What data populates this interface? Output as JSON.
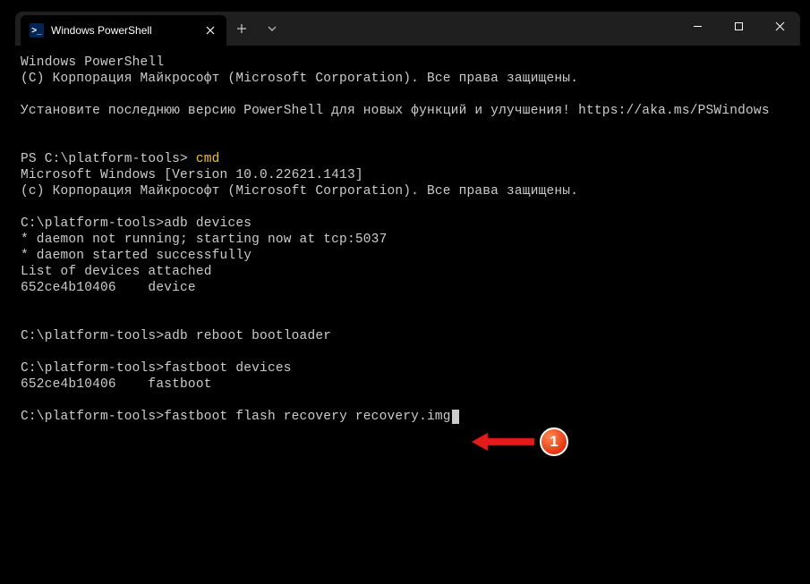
{
  "tab": {
    "title": "Windows PowerShell",
    "icon_text": ">_"
  },
  "terminal": {
    "lines": [
      {
        "t": "Windows PowerShell"
      },
      {
        "t": "(C) Корпорация Майкрософт (Microsoft Corporation). Все права защищены."
      },
      {
        "t": ""
      },
      {
        "t": "Установите последнюю версию PowerShell для новых функций и улучшения! https://aka.ms/PSWindows"
      },
      {
        "t": ""
      },
      {
        "t": ""
      },
      {
        "prompt": "PS C:\\platform-tools> ",
        "cmd": "cmd",
        "cmd_style": "yellow"
      },
      {
        "t": "Microsoft Windows [Version 10.0.22621.1413]"
      },
      {
        "t": "(c) Корпорация Майкрософт (Microsoft Corporation). Все права защищены."
      },
      {
        "t": ""
      },
      {
        "prompt": "C:\\platform-tools>",
        "cmd": "adb devices"
      },
      {
        "t": "* daemon not running; starting now at tcp:5037"
      },
      {
        "t": "* daemon started successfully"
      },
      {
        "t": "List of devices attached"
      },
      {
        "t": "652ce4b10406    device"
      },
      {
        "t": ""
      },
      {
        "t": ""
      },
      {
        "prompt": "C:\\platform-tools>",
        "cmd": "adb reboot bootloader"
      },
      {
        "t": ""
      },
      {
        "prompt": "C:\\platform-tools>",
        "cmd": "fastboot devices"
      },
      {
        "t": "652ce4b10406    fastboot"
      },
      {
        "t": ""
      },
      {
        "prompt": "C:\\platform-tools>",
        "cmd": "fastboot flash recovery recovery.img",
        "cursor": true
      }
    ]
  },
  "annotation": {
    "badge_number": "1"
  }
}
